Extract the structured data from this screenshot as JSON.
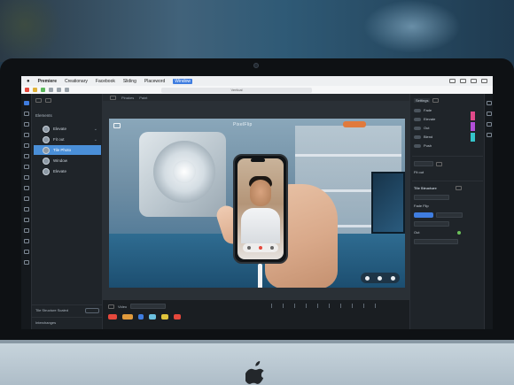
{
  "menubar": {
    "app_name": "Premiere",
    "items": [
      "Creationary",
      "Facebook",
      "Sliding",
      "Placeword",
      "Window"
    ],
    "highlighted_item": "Window"
  },
  "toolbar": {
    "url_text": "Vertical"
  },
  "layers": {
    "title": "Elements",
    "items": [
      {
        "label": "Elevate"
      },
      {
        "label": "Fit out"
      },
      {
        "label": "Tile Photo"
      },
      {
        "label": "Window"
      },
      {
        "label": "Elevate"
      }
    ],
    "active_index": 2,
    "footer_label": "Tile Structure Scaled",
    "footer2_label": "Interchanges"
  },
  "canvas": {
    "tabs": [
      "Pinakes",
      "Paint"
    ],
    "scene_logo": "PixelFlip",
    "scene_badge_color": "#e07a3c"
  },
  "timeline": {
    "label": "Video"
  },
  "props": {
    "title": "Settings",
    "rows": [
      "Fade",
      "Elevate",
      "Out",
      "Blend",
      "Push",
      "Fit out",
      "Out"
    ],
    "section_title": "Tile Structure",
    "sub_title": "Fade Flip",
    "accent": "#3f7de0",
    "swatches": [
      "#e04a8a",
      "#b24fd8",
      "#35c4c9"
    ]
  },
  "colors": {
    "active_layer": "#4a8fd8",
    "accent": "#3f7de0"
  }
}
